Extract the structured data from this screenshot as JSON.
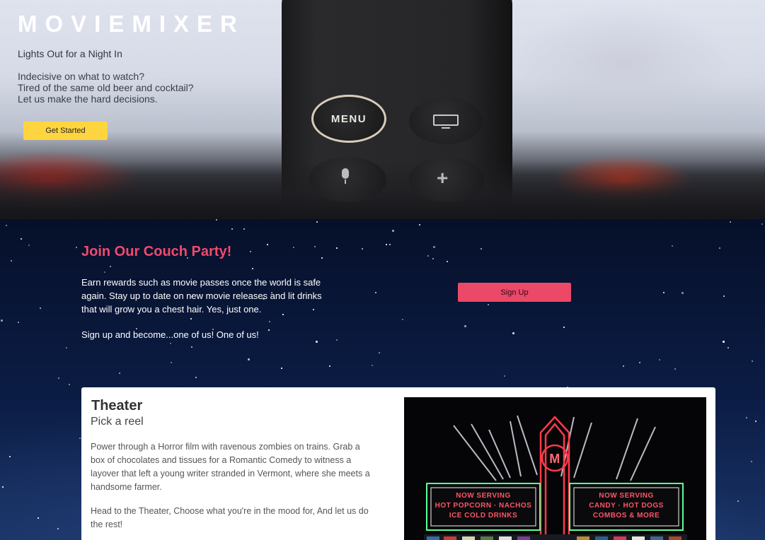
{
  "hero": {
    "brand": "MOVIEMIXER",
    "tagline": "Lights Out for a Night In",
    "lines": [
      "Indecisive on what to watch?",
      "Tired of the same old beer and cocktail?",
      "Let us make the hard decisions."
    ],
    "cta_label": "Get Started",
    "remote": {
      "menu_label": "MENU",
      "icons": [
        "tv-icon",
        "microphone-icon",
        "plus-icon"
      ]
    }
  },
  "party": {
    "title": "Join Our Couch Party!",
    "text_lines": [
      "Earn rewards such as movie passes once the world is safe",
      "again. Stay up to date on new movie releases and lit drinks",
      "that will grow you a chest hair. Yes, just one."
    ],
    "cta_text": "Sign up and become...one of us! One of us!",
    "signup_label": "Sign Up"
  },
  "theater": {
    "title": "Theater",
    "subtitle": "Pick a reel",
    "paragraph1": [
      "Power through a Horror film with ravenous zombies on trains. Grab a",
      "box of chocolates and tissues for a Romantic Comedy to witness a",
      "layover that left a young writer stranded in Vermont, where she meets a",
      "handsome farmer."
    ],
    "paragraph2": [
      "Head to the Theater, Choose what you're in the mood for, And let us do",
      "the rest!"
    ],
    "sign_left": [
      "NOW SERVING",
      "HOT POPCORN · NACHOS",
      "ICE COLD DRINKS"
    ],
    "sign_right": [
      "NOW SERVING",
      "CANDY · HOT DOGS",
      "COMBOS & MORE"
    ]
  },
  "colors": {
    "accent_yellow": "#ffd53f",
    "accent_pink": "#ec4868",
    "title_pink": "#f04a6d",
    "neon_red": "#ff3a4a",
    "neon_green": "#5dff9a"
  }
}
